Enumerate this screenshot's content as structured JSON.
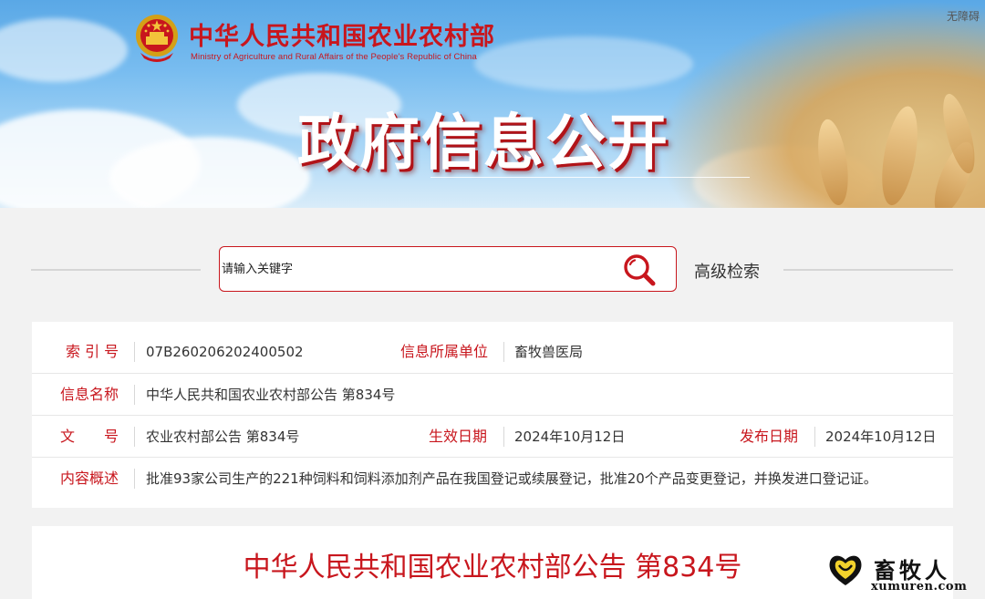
{
  "header": {
    "logo_cn": "中华人民共和国农业农村部",
    "logo_en": "Ministry of Agriculture and Rural Affairs of the People's Republic of China",
    "accessibility_link": "无障碍",
    "banner_title": "政府信息公开"
  },
  "search": {
    "placeholder": "请输入关键字",
    "advanced_label": "高级检索"
  },
  "info": {
    "index_label": "索 引 号",
    "index_value": "07B260206202400502",
    "unit_label": "信息所属单位",
    "unit_value": "畜牧兽医局",
    "name_label": "信息名称",
    "name_value": "中华人民共和国农业农村部公告 第834号",
    "docno_label": "文　　号",
    "docno_value": "农业农村部公告 第834号",
    "effective_label": "生效日期",
    "effective_value": "2024年10月12日",
    "publish_label": "发布日期",
    "publish_value": "2024年10月12日",
    "summary_label": "内容概述",
    "summary_value": "批准93家公司生产的221种饲料和饲料添加剂产品在我国登记或续展登记，批准20个产品变更登记，并换发进口登记证。"
  },
  "article": {
    "title": "中华人民共和国农业农村部公告 第834号"
  },
  "watermark": {
    "cn": "畜牧人",
    "en": "xumuren.com"
  },
  "colors": {
    "brand_red": "#c8161d",
    "sky_blue": "#79bdf0"
  },
  "icons": [
    "national-emblem-icon",
    "search-icon",
    "watermark-logo-icon"
  ]
}
